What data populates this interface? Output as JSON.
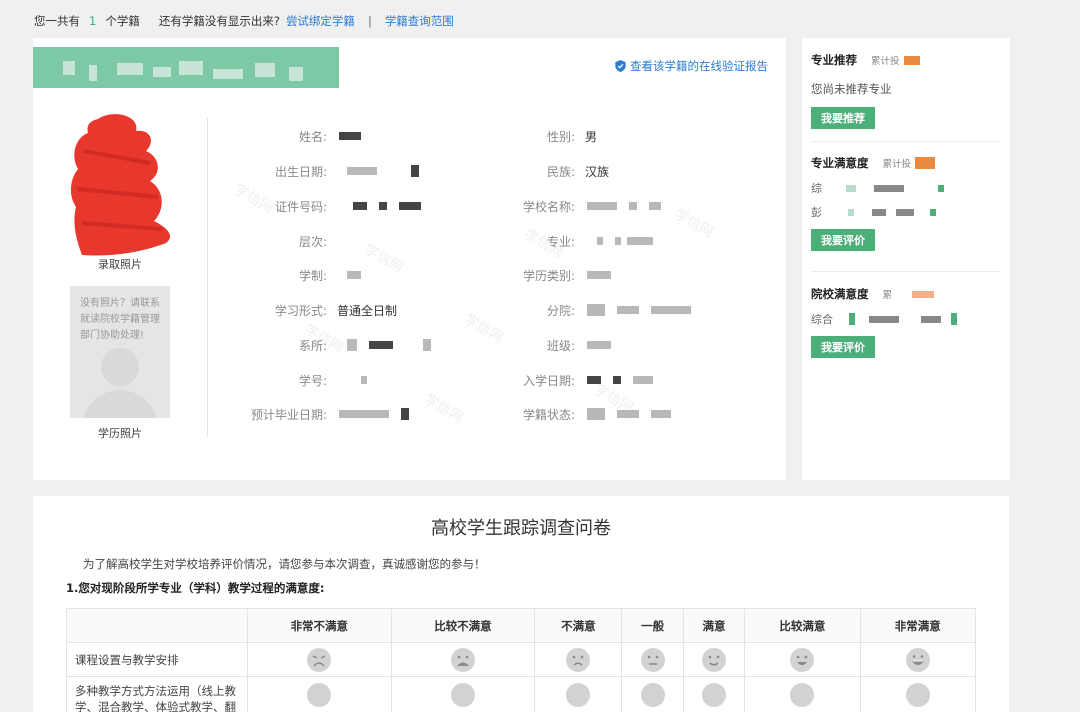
{
  "topbar": {
    "prefix": "您一共有",
    "count": "1",
    "suffix": "个学籍",
    "missing_prompt": "还有学籍没有显示出来?",
    "bind_link": "尝试绑定学籍",
    "separator": "|",
    "scope_link": "学籍查询范围"
  },
  "record": {
    "verify_link": "查看该学籍的在线验证报告",
    "photo1_caption": "录取照片",
    "photo2_message": "没有照片？请联系就读院校学籍管理部门协助处理!",
    "photo2_caption": "学历照片",
    "fields_left": [
      {
        "label": "姓名:",
        "value": ""
      },
      {
        "label": "出生日期:",
        "value": ""
      },
      {
        "label": "证件号码:",
        "value": ""
      },
      {
        "label": "层次:",
        "value": ""
      },
      {
        "label": "学制:",
        "value": ""
      },
      {
        "label": "学习形式:",
        "value": "普通全日制"
      },
      {
        "label": "系所:",
        "value": ""
      },
      {
        "label": "学号:",
        "value": ""
      },
      {
        "label": "预计毕业日期:",
        "value": ""
      }
    ],
    "fields_right": [
      {
        "label": "性别:",
        "value": "男"
      },
      {
        "label": "民族:",
        "value": "汉族"
      },
      {
        "label": "学校名称:",
        "value": ""
      },
      {
        "label": "专业:",
        "value": ""
      },
      {
        "label": "学历类别:",
        "value": ""
      },
      {
        "label": "分院:",
        "value": ""
      },
      {
        "label": "班级:",
        "value": ""
      },
      {
        "label": "入学日期:",
        "value": ""
      },
      {
        "label": "学籍状态:",
        "value": ""
      }
    ],
    "watermark": "学信网"
  },
  "sidebar": {
    "recommend": {
      "title": "专业推荐",
      "acc": "累计投",
      "empty": "您尚未推荐专业",
      "button": "我要推荐"
    },
    "major_satisfaction": {
      "title": "专业满意度",
      "acc": "累计投",
      "row1": "综",
      "row2": "彭",
      "button": "我要评价"
    },
    "school_satisfaction": {
      "title": "院校满意度",
      "acc": "累",
      "row1": "综合",
      "button": "我要评价"
    }
  },
  "survey": {
    "title": "高校学生跟踪调查问卷",
    "intro": "为了解高校学生对学校培养评价情况，请您参与本次调查，真诚感谢您的参与！",
    "question": "1.您对现阶段所学专业（学科）教学过程的满意度:",
    "columns": [
      "非常不满意",
      "比较不满意",
      "不满意",
      "一般",
      "满意",
      "比较满意",
      "非常满意"
    ],
    "rows": [
      "课程设置与教学安排",
      "多种教学方式方法运用（线上教学、混合教学、体验式教学、翻"
    ]
  },
  "colors": {
    "accent": "#4caf7a",
    "link": "#2a7bd4",
    "banner": "#7dc9a6",
    "brand_green": "#2bb07c"
  },
  "icons": [
    "shield-check-icon",
    "very-dissatisfied-face-icon",
    "dissatisfied-face-icon",
    "unhappy-face-icon",
    "neutral-face-icon",
    "satisfied-face-icon",
    "happy-face-icon",
    "very-happy-face-icon"
  ]
}
